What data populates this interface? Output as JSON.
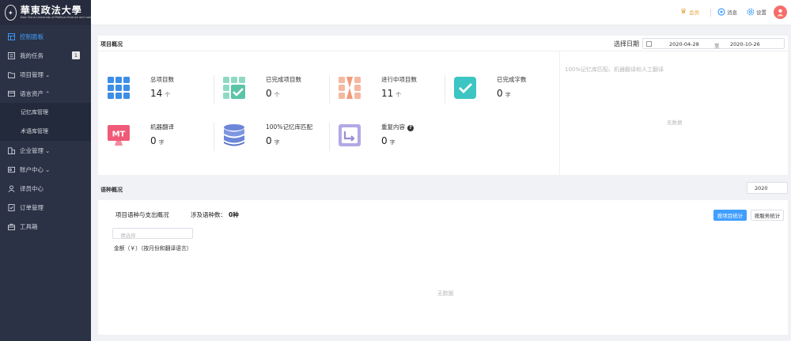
{
  "logo": {
    "name": "華東政法大學",
    "subtitle": "East China University of Political Science and Law"
  },
  "sidebar": {
    "items": [
      {
        "label": "控制面板",
        "icon": "dashboard-icon",
        "active": true
      },
      {
        "label": "我的任务",
        "icon": "task-icon",
        "badge": "1"
      },
      {
        "label": "项目管理",
        "icon": "folder-icon",
        "chevron": "⌄"
      },
      {
        "label": "语言资产",
        "icon": "asset-icon",
        "chevron": "⌃"
      },
      {
        "label": "企业管理",
        "icon": "building-icon",
        "chevron": "⌄"
      },
      {
        "label": "账户中心",
        "icon": "account-icon",
        "chevron": "⌄"
      },
      {
        "label": "译员中心",
        "icon": "user-icon"
      },
      {
        "label": "订单管理",
        "icon": "order-icon"
      },
      {
        "label": "工具箱",
        "icon": "toolbox-icon"
      }
    ],
    "sub_items": [
      "记忆库管理",
      "术语库管理"
    ]
  },
  "header": {
    "member_label": "会员",
    "message_label": "消息",
    "settings_label": "设置"
  },
  "overview": {
    "title": "项目概况",
    "date_label": "选择日期",
    "date_start": "2020-04-28",
    "date_sep": "至",
    "date_end": "2020-10-26",
    "stats": [
      {
        "label": "总项目数",
        "value": "14",
        "unit": "个",
        "icon": "grid-icon",
        "color": "#3d8ee6"
      },
      {
        "label": "已完成项目数",
        "value": "0",
        "unit": "个",
        "icon": "grid-check-icon",
        "color": "#5bc4a8"
      },
      {
        "label": "进行中项目数",
        "value": "11",
        "unit": "个",
        "icon": "hourglass-grid-icon",
        "color": "#f19a7a"
      },
      {
        "label": "已完成字数",
        "value": "0",
        "unit": "字",
        "icon": "check-square-icon",
        "color": "#3cc5c3"
      },
      {
        "label": "机器翻译",
        "value": "0",
        "unit": "字",
        "icon": "mt-screen-icon",
        "color": "#f05a78"
      },
      {
        "label": "100%记忆库匹配",
        "value": "0",
        "unit": "字",
        "icon": "database-icon",
        "color": "#6c86d8"
      },
      {
        "label": "重复内容",
        "value": "0",
        "unit": "字",
        "icon": "repeat-square-icon",
        "color": "#9b8dd6",
        "help": "?"
      }
    ],
    "chart_tip": "100%记忆库匹配、机器翻译和人工翻译",
    "empty_text": "无数据"
  },
  "language_overview": {
    "title": "语种概况",
    "year": "2020",
    "subtitle": "项目语种与支出概况",
    "count_label": "涉及语种数：",
    "count_value": "0种",
    "btn_project_stats": "按项目统计",
    "btn_service_stats": "按服务统计",
    "language_placeholder": "请选择",
    "amount_label": "金额（￥）（按月份和翻译语言）",
    "empty_text": "无数据"
  }
}
